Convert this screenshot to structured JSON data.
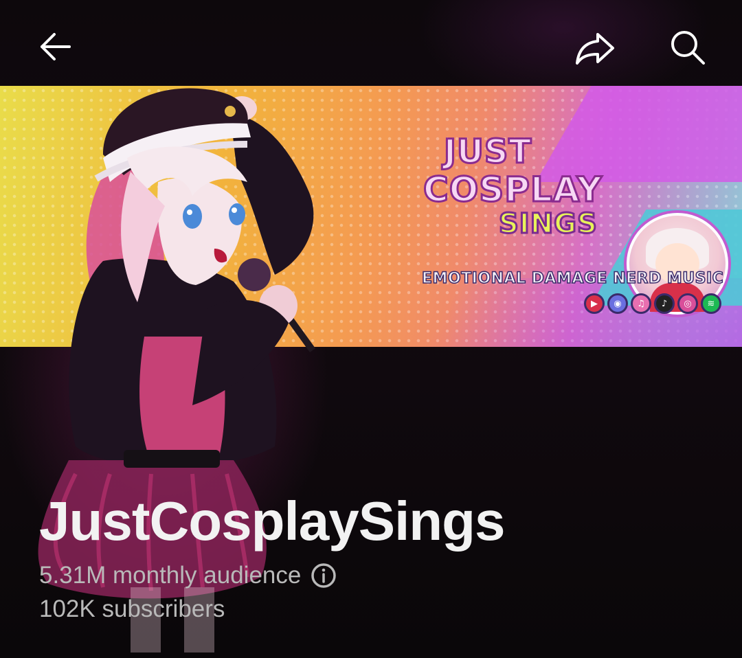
{
  "topbar": {
    "back_icon": "arrow-left-icon",
    "share_icon": "share-arrow-icon",
    "search_icon": "search-icon"
  },
  "banner": {
    "logo_line1": "JUST",
    "logo_line2": "COSPLAY",
    "logo_line3": "SINGS",
    "tagline": "EMOTIONAL DAMAGE NERD MUSIC",
    "socials": [
      {
        "name": "youtube-icon",
        "glyph": "▶",
        "color": "#d8304a"
      },
      {
        "name": "discord-icon",
        "glyph": "◉",
        "color": "#6a6fe0"
      },
      {
        "name": "music-icon",
        "glyph": "♫",
        "color": "#e86fb0"
      },
      {
        "name": "tiktok-icon",
        "glyph": "♪",
        "color": "#222222"
      },
      {
        "name": "instagram-icon",
        "glyph": "◎",
        "color": "#d94f9a"
      },
      {
        "name": "spotify-icon",
        "glyph": "≋",
        "color": "#1db954"
      }
    ]
  },
  "channel": {
    "name": "JustCosplaySings",
    "monthly_audience": "5.31M monthly audience",
    "subscribers": "102K subscribers",
    "info_icon": "info-icon"
  },
  "colors": {
    "text_primary": "#f2f2f2",
    "text_secondary": "#b9b9b9",
    "background": "#0d080c"
  }
}
